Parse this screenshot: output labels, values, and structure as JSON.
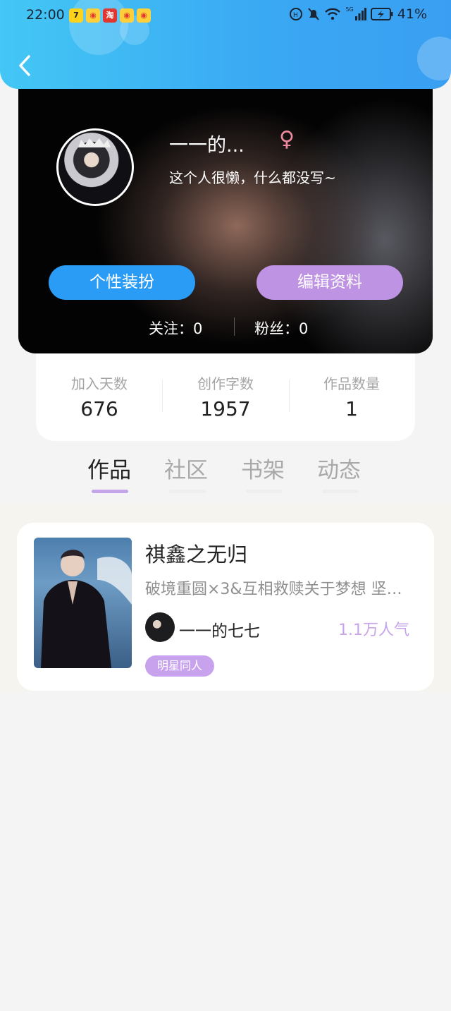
{
  "status_bar": {
    "time": "22:00",
    "battery": "41%",
    "network": "5G",
    "app_icons": [
      "app-7-icon",
      "weibo-icon",
      "taobao-icon",
      "weibo-icon",
      "weibo-icon"
    ]
  },
  "profile": {
    "username": "一一的...",
    "gender_symbol": "♀",
    "bio": "这个人很懒，什么都没写~",
    "dress_button": "个性装扮",
    "edit_button": "编辑资料",
    "following_label": "关注：0",
    "followers_label": "粉丝：0"
  },
  "stats": [
    {
      "label": "加入天数",
      "value": "676"
    },
    {
      "label": "创作字数",
      "value": "1957"
    },
    {
      "label": "作品数量",
      "value": "1"
    }
  ],
  "tabs": [
    {
      "label": "作品",
      "active": true
    },
    {
      "label": "社区",
      "active": false
    },
    {
      "label": "书架",
      "active": false
    },
    {
      "label": "动态",
      "active": false
    }
  ],
  "works": [
    {
      "title": "祺鑫之无归",
      "description": "破境重圆×3&互相救赎关于梦想 坚…",
      "author": "一一的七七",
      "popularity": "1.1万人气",
      "tag": "明星同人"
    }
  ],
  "colors": {
    "header": "#3aa8f3",
    "dress_button": "#2b9cf5",
    "edit_button": "#bf93e3",
    "accent_purple": "#c8a4eb"
  }
}
